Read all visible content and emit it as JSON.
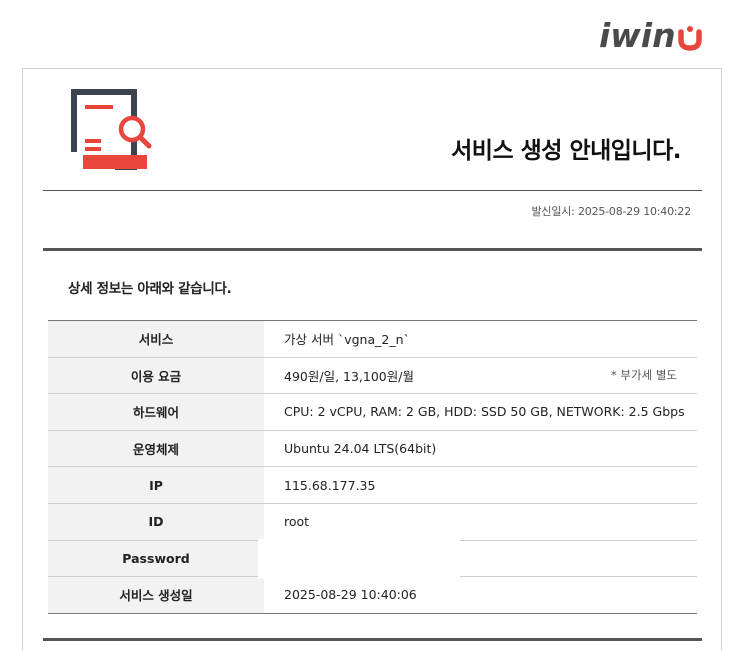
{
  "brand": {
    "logo_text": "iwin",
    "accent": "#e8453c"
  },
  "header": {
    "title": "서비스 생성 안내입니다.",
    "icon": "document-search-icon"
  },
  "meta": {
    "sent_at": "발신일시: 2025-08-29 10:40:22"
  },
  "section": {
    "title": "상세 정보는 아래와 같습니다."
  },
  "table": {
    "rows": [
      {
        "label": "서비스",
        "value": "가상 서버 `vgna_2_n`",
        "note": ""
      },
      {
        "label": "이용 요금",
        "value": "490원/일, 13,100원/월",
        "note": "* 부가세 별도"
      },
      {
        "label": "하드웨어",
        "value": "CPU: 2 vCPU, RAM: 2 GB, HDD: SSD 50 GB, NETWORK: 2.5 Gbps",
        "note": ""
      },
      {
        "label": "운영체제",
        "value": "Ubuntu 24.04 LTS(64bit)",
        "note": ""
      },
      {
        "label": "IP",
        "value": "115.68.177.35",
        "note": ""
      },
      {
        "label": "ID",
        "value": "root",
        "note": ""
      },
      {
        "label": "Password",
        "value": "",
        "note": ""
      },
      {
        "label": "서비스 생성일",
        "value": "2025-08-29 10:40:06",
        "note": ""
      }
    ]
  },
  "colors": {
    "text_dark": "#111111",
    "label_bg": "#f2f2f2",
    "icon_dark": "#3d4451",
    "icon_red": "#e8453c"
  }
}
